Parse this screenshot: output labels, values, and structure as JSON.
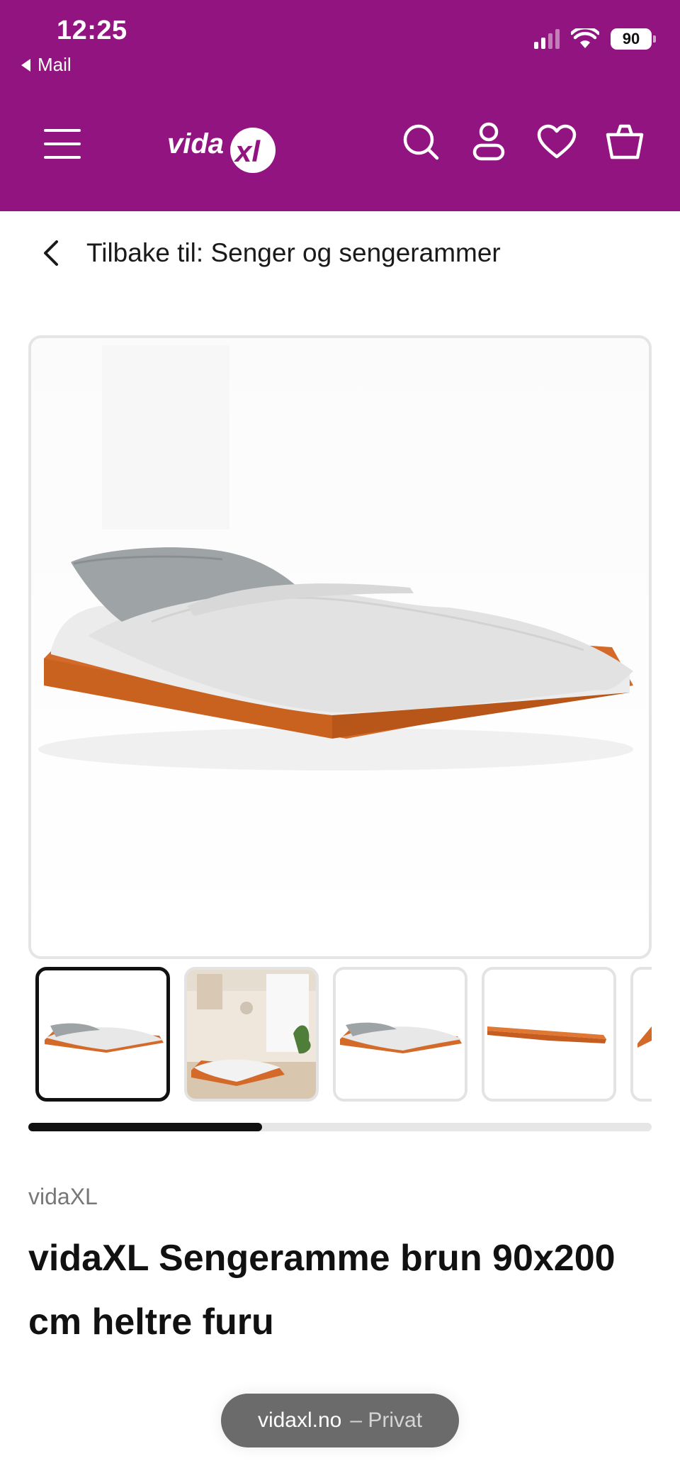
{
  "status_bar": {
    "time": "12:25",
    "back_app": "Mail",
    "battery": "90"
  },
  "header": {
    "logo_text": "vidaXL",
    "icons": [
      "menu-icon",
      "search-icon",
      "account-icon",
      "heart-icon",
      "cart-icon"
    ]
  },
  "breadcrumb": {
    "text": "Tilbake til: Senger og sengerammer"
  },
  "gallery": {
    "thumbnails_count_visible": 5,
    "active_index": 0,
    "scroll_progress": 0.375
  },
  "product": {
    "brand": "vidaXL",
    "title": "vidaXL Sengeramme brun 90x200 cm heltre furu"
  },
  "browser": {
    "domain": "vidaxl.no",
    "mode": "– Privat"
  },
  "colors": {
    "header_bg": "#921480",
    "wood": "#d46a2a"
  }
}
